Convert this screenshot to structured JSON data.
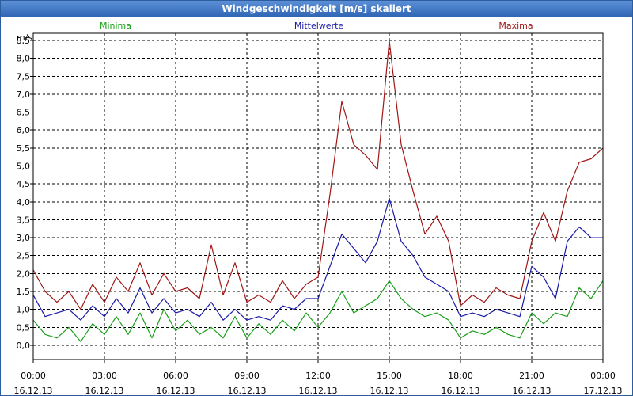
{
  "window": {
    "title": "Windgeschwindigkeit [m/s] skaliert"
  },
  "legend": {
    "min": {
      "label": "Minima",
      "color": "#19a019"
    },
    "mean": {
      "label": "Mittelwerte",
      "color": "#1a1aa8"
    },
    "max": {
      "label": "Maxima",
      "color": "#a01616"
    }
  },
  "chart_data": {
    "type": "line",
    "title": "Windgeschwindigkeit [m/s] skaliert",
    "ylabel": "m/s",
    "ylim": [
      -0.4,
      8.7
    ],
    "yticks": [
      0,
      0.5,
      1,
      1.5,
      2,
      2.5,
      3,
      3.5,
      4,
      4.5,
      5,
      5.5,
      6,
      6.5,
      7,
      7.5,
      8,
      8.5
    ],
    "ytick_labels": [
      "0,0",
      "0,5",
      "1,0",
      "1,5",
      "2,0",
      "2,5",
      "3,0",
      "3,5",
      "4,0",
      "4,5",
      "5,0",
      "5,5",
      "6,0",
      "6,5",
      "7,0",
      "7,5",
      "8,0",
      "8,5"
    ],
    "x_unit": "hours since 16.12.13 00:00",
    "xlim": [
      0,
      24
    ],
    "xticks": [
      0,
      3,
      6,
      9,
      12,
      15,
      18,
      21,
      24
    ],
    "xtick_labels": [
      [
        "00:00",
        "16.12.13"
      ],
      [
        "03:00",
        "16.12.13"
      ],
      [
        "06:00",
        "16.12.13"
      ],
      [
        "09:00",
        "16.12.13"
      ],
      [
        "12:00",
        "16.12.13"
      ],
      [
        "15:00",
        "16.12.13"
      ],
      [
        "18:00",
        "16.12.13"
      ],
      [
        "21:00",
        "16.12.13"
      ],
      [
        "00:00",
        "17.12.13"
      ]
    ],
    "grid": true,
    "legend_position": "top",
    "x": [
      0,
      0.5,
      1,
      1.5,
      2,
      2.5,
      3,
      3.5,
      4,
      4.5,
      5,
      5.5,
      6,
      6.5,
      7,
      7.5,
      8,
      8.5,
      9,
      9.5,
      10,
      10.5,
      11,
      11.5,
      12,
      12.5,
      13,
      13.5,
      14,
      14.5,
      15,
      15.5,
      16,
      16.5,
      17,
      17.5,
      18,
      18.5,
      19,
      19.5,
      20,
      20.5,
      21,
      21.5,
      22,
      22.5,
      23,
      23.5,
      24
    ],
    "series": [
      {
        "name": "Minima",
        "key": "min",
        "color": "#19a019",
        "values": [
          0.7,
          0.3,
          0.2,
          0.5,
          0.1,
          0.6,
          0.3,
          0.8,
          0.3,
          0.9,
          0.2,
          1.0,
          0.4,
          0.7,
          0.3,
          0.5,
          0.2,
          0.8,
          0.2,
          0.6,
          0.3,
          0.7,
          0.4,
          0.9,
          0.5,
          0.9,
          1.5,
          0.9,
          1.1,
          1.3,
          1.8,
          1.3,
          1.0,
          0.8,
          0.9,
          0.7,
          0.2,
          0.4,
          0.3,
          0.5,
          0.3,
          0.2,
          0.9,
          0.6,
          0.9,
          0.8,
          1.6,
          1.3,
          1.8
        ]
      },
      {
        "name": "Mittelwerte",
        "key": "mean",
        "color": "#1a1aa8",
        "values": [
          1.4,
          0.8,
          0.9,
          1.0,
          0.7,
          1.1,
          0.8,
          1.3,
          0.9,
          1.6,
          0.9,
          1.3,
          0.9,
          1.0,
          0.8,
          1.2,
          0.7,
          1.0,
          0.7,
          0.8,
          0.7,
          1.1,
          1.0,
          1.3,
          1.3,
          2.2,
          3.1,
          2.7,
          2.3,
          2.9,
          4.1,
          2.9,
          2.5,
          1.9,
          1.7,
          1.5,
          0.8,
          0.9,
          0.8,
          1.0,
          0.9,
          0.8,
          2.2,
          1.9,
          1.3,
          2.9,
          3.3,
          3.0,
          3.0
        ]
      },
      {
        "name": "Maxima",
        "key": "max",
        "color": "#a01616",
        "values": [
          2.1,
          1.5,
          1.2,
          1.5,
          1.0,
          1.7,
          1.2,
          1.9,
          1.5,
          2.3,
          1.4,
          2.0,
          1.5,
          1.6,
          1.3,
          2.8,
          1.4,
          2.3,
          1.2,
          1.4,
          1.2,
          1.8,
          1.3,
          1.7,
          1.9,
          4.2,
          6.8,
          5.6,
          5.3,
          4.9,
          8.5,
          5.6,
          4.3,
          3.1,
          3.6,
          2.9,
          1.1,
          1.4,
          1.2,
          1.6,
          1.4,
          1.3,
          2.9,
          3.7,
          2.9,
          4.3,
          5.1,
          5.2,
          5.5
        ]
      }
    ]
  }
}
